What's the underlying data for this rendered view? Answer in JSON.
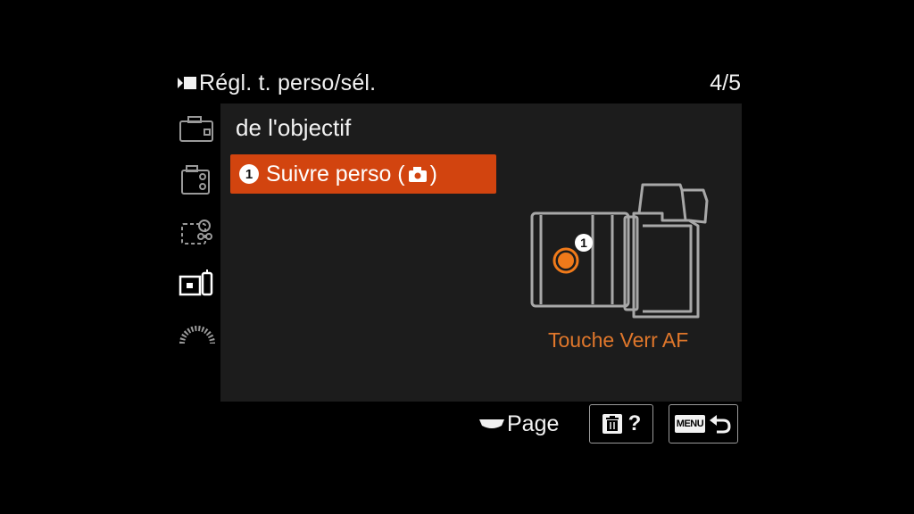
{
  "header": {
    "title": "Régl. t. perso/sél.",
    "page_indicator": "4/5"
  },
  "tabs": [
    {
      "icon": "camera-settings-icon"
    },
    {
      "icon": "camera-settings-2-icon"
    },
    {
      "icon": "network-icon"
    },
    {
      "icon": "custom-operation-icon",
      "selected": true
    },
    {
      "icon": "setup-icon"
    }
  ],
  "main": {
    "section_heading": "de l'objectif",
    "menu_item": {
      "number": "1",
      "label_prefix": "Suivre perso (",
      "label_suffix": ")",
      "icon": "camera-icon"
    },
    "camera_label": "Touche Verr AF",
    "callout_number": "1"
  },
  "footer": {
    "page_label": "Page",
    "help_label": "?",
    "menu_label": "MENU"
  },
  "colors": {
    "accent": "#d2440f",
    "label": "#e0772b",
    "panel": "#1c1c1c"
  }
}
